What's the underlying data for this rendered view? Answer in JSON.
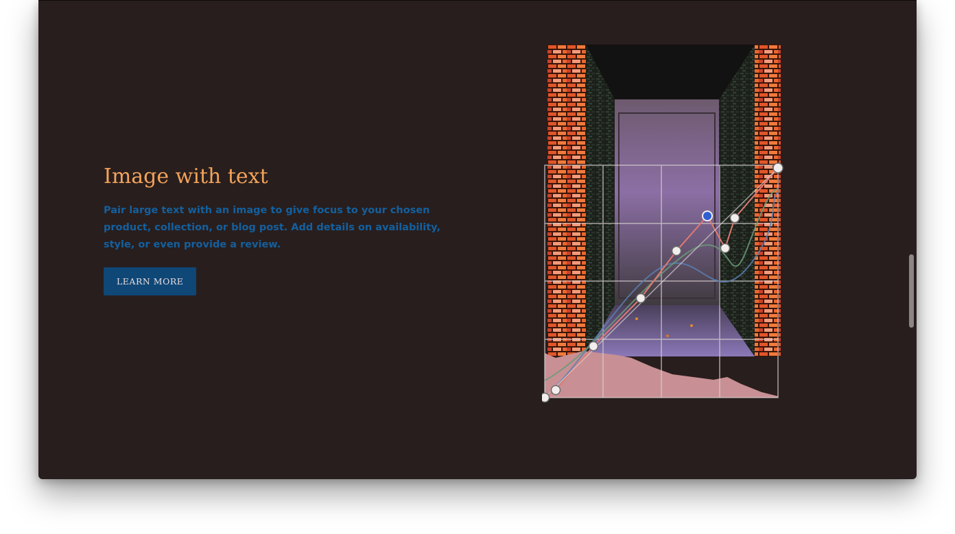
{
  "section": {
    "heading": "Image with text",
    "body": "Pair large text with an image to give focus to your chosen product, collection, or blog post. Add details on availability, style, or even provide a review.",
    "button_label": "LEARN MORE"
  },
  "image": {
    "description_icon": "alley-photo-with-curves-editor-icon"
  },
  "colors": {
    "background": "#281e1d",
    "heading": "#f3a35a",
    "body": "#13609f",
    "button_bg": "#0f4777",
    "button_text": "#e9dede"
  }
}
